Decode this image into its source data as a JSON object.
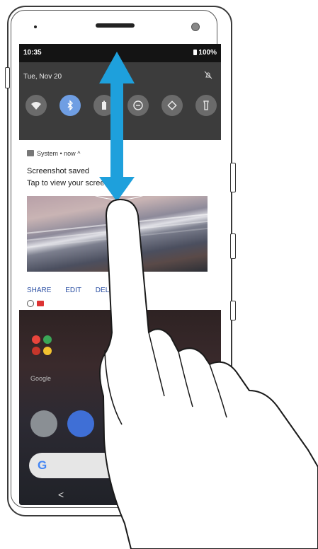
{
  "status_bar": {
    "time": "10:35",
    "battery": "100%"
  },
  "quick_settings": {
    "date": "Tue, Nov 20",
    "tiles": [
      {
        "icon": "wifi-icon",
        "active": false
      },
      {
        "icon": "bluetooth-icon",
        "active": true
      },
      {
        "icon": "battery-saver-icon",
        "active": false
      },
      {
        "icon": "do-not-disturb-icon",
        "active": false
      },
      {
        "icon": "auto-rotate-icon",
        "active": false
      },
      {
        "icon": "flashlight-icon",
        "active": false
      }
    ]
  },
  "notification": {
    "app": "System",
    "time": "now",
    "title": "Screenshot saved",
    "text": "Tap to view your screenshot",
    "actions": [
      "SHARE",
      "EDIT",
      "DELETE"
    ]
  },
  "home": {
    "folder_label": "Google"
  },
  "colors": {
    "accent": "#6f9ee3",
    "arrow": "#1ea0dc",
    "link": "#2b4fa3"
  }
}
